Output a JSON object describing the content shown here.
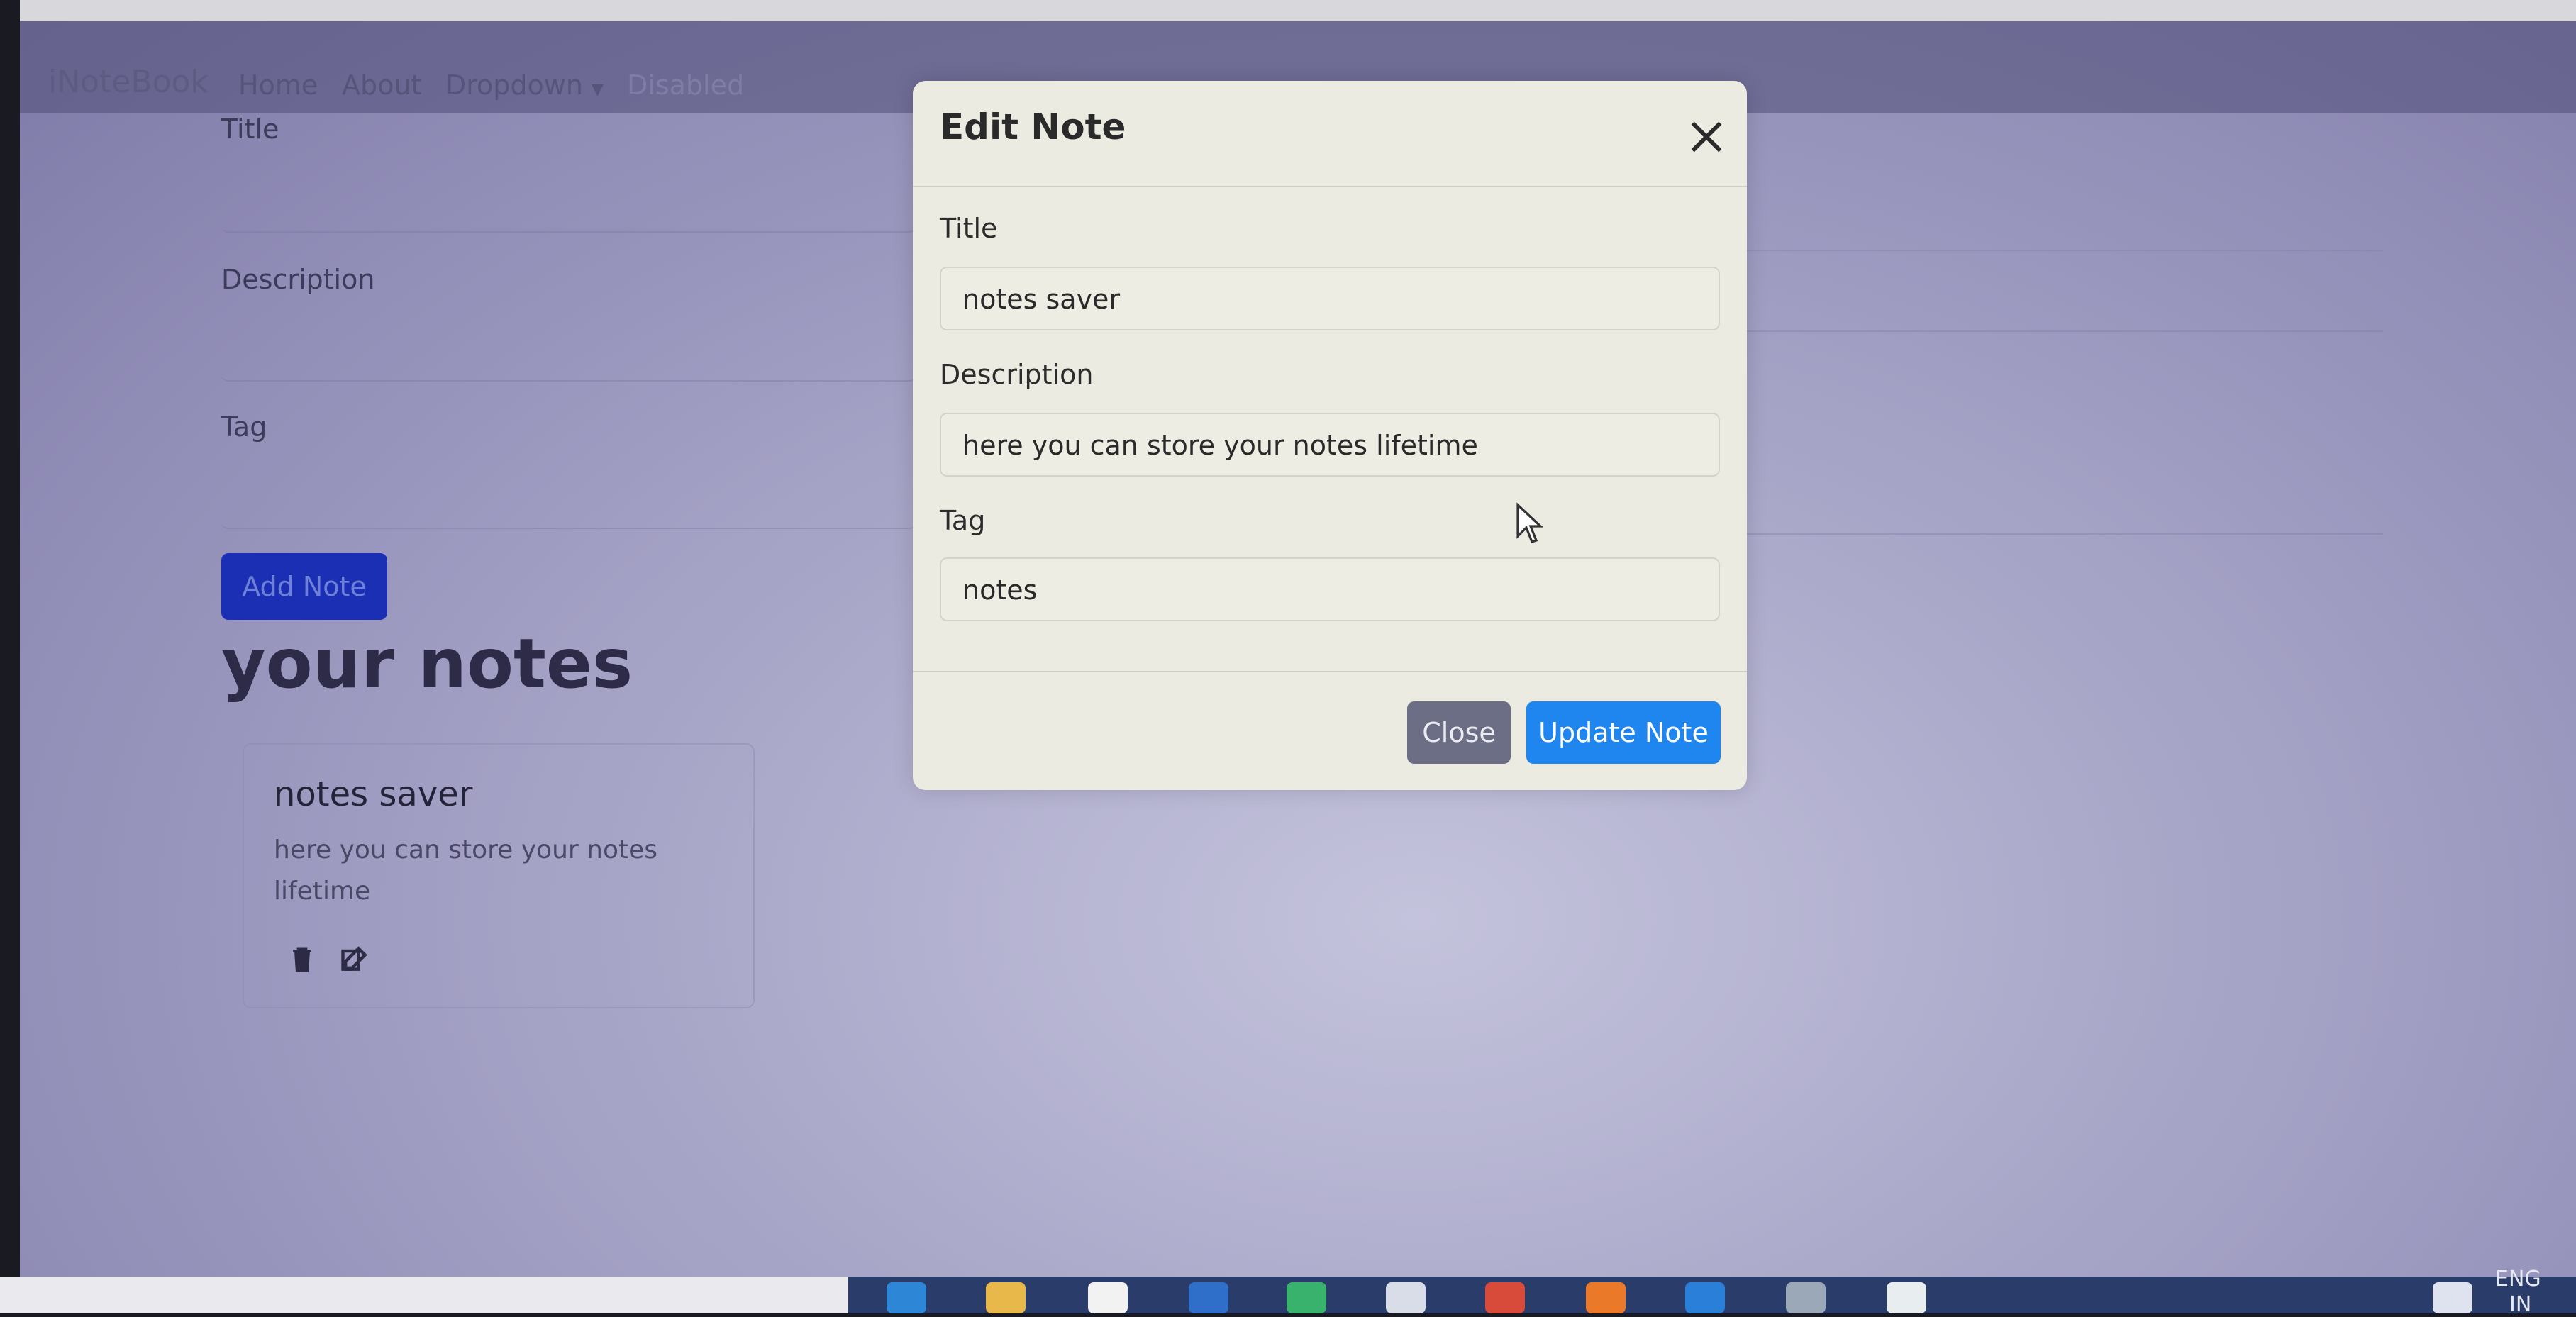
{
  "navbar": {
    "brand": "iNoteBook",
    "links": [
      "Home",
      "About",
      "Dropdown",
      "Disabled"
    ]
  },
  "add_form": {
    "title_label": "Title",
    "description_label": "Description",
    "tag_label": "Tag",
    "add_button": "Add Note"
  },
  "notes_section": {
    "heading": "your notes",
    "notes": [
      {
        "title": "notes saver",
        "description": "here you can store your notes lifetime"
      }
    ]
  },
  "modal": {
    "title": "Edit Note",
    "fields": {
      "title": {
        "label": "Title",
        "value": "notes saver"
      },
      "description": {
        "label": "Description",
        "value": "here you can store your notes lifetime"
      },
      "tag": {
        "label": "Tag",
        "value": "notes"
      }
    },
    "close_button": "Close",
    "update_button": "Update Note"
  },
  "taskbar": {
    "language": "ENG",
    "region": "IN"
  },
  "colors": {
    "primary": "#1f86f0",
    "secondary": "#6b6e84",
    "overlay": "#8f8cb6"
  }
}
